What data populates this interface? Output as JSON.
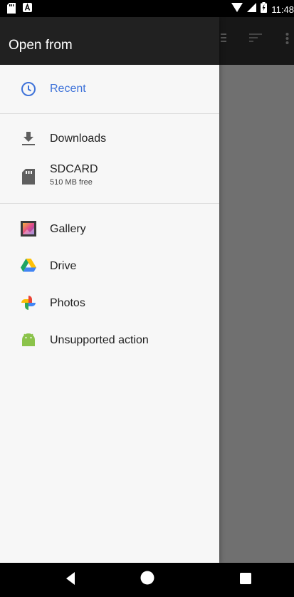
{
  "status_bar": {
    "time": "11:48",
    "left_icons": [
      "sd-card-icon",
      "notification-a-icon"
    ],
    "right_icons": [
      "wifi-icon",
      "cellular-signal-icon",
      "battery-charging-icon"
    ]
  },
  "background_toolbar": {
    "icons": [
      "view-list-icon",
      "sort-icon",
      "more-options-icon"
    ]
  },
  "drawer": {
    "title": "Open from",
    "items": [
      {
        "label": "Recent",
        "icon": "clock-icon",
        "selected": true
      },
      {
        "label": "Downloads",
        "icon": "download-icon"
      },
      {
        "label": "SDCARD",
        "subtitle": "510 MB free",
        "icon": "sd-card-icon"
      },
      {
        "label": "Gallery",
        "icon": "gallery-icon"
      },
      {
        "label": "Drive",
        "icon": "drive-icon"
      },
      {
        "label": "Photos",
        "icon": "photos-icon"
      },
      {
        "label": "Unsupported action",
        "icon": "android-icon"
      }
    ]
  },
  "nav_bar": {
    "buttons": [
      "back-icon",
      "home-icon",
      "recents-icon"
    ]
  },
  "colors": {
    "accent": "#3f73d9",
    "header": "#212121",
    "drawer_bg": "#f7f7f7",
    "scrim": "#707070"
  }
}
